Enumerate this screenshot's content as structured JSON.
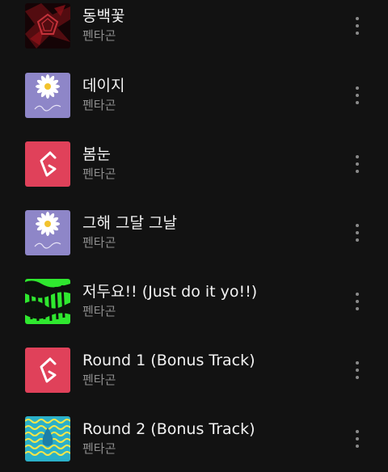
{
  "songs": [
    {
      "title": "동백꽃",
      "artist": "펜타곤",
      "art": "red-pentagon-art-icon"
    },
    {
      "title": "데이지",
      "artist": "펜타곤",
      "art": "daisy-art-icon"
    },
    {
      "title": "봄눈",
      "artist": "펜타곤",
      "art": "pink-logo-art-icon"
    },
    {
      "title": "그해 그달 그날",
      "artist": "펜타곤",
      "art": "daisy-art-icon"
    },
    {
      "title": "저두요!! (Just do it yo!!)",
      "artist": "펜타곤",
      "art": "green-text-art-icon"
    },
    {
      "title": "Round 1 (Bonus Track)",
      "artist": "펜타곤",
      "art": "pink-logo-art-icon"
    },
    {
      "title": "Round 2 (Bonus Track)",
      "artist": "펜타곤",
      "art": "wave-art-icon"
    }
  ],
  "more_icon": "more-vertical-icon",
  "colors": {
    "background": "#121212",
    "title": "#f2f2f2",
    "artist": "#8f8f8f",
    "pink": "#e0415a",
    "daisy_bg": "#8e86c8",
    "green": "#2fe82f"
  }
}
